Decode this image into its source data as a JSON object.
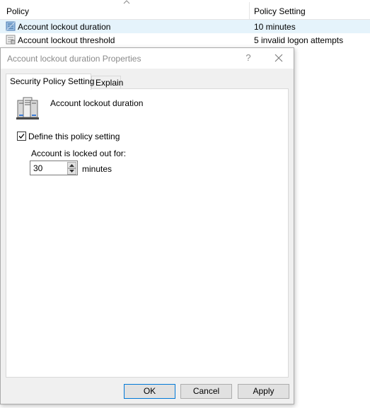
{
  "list": {
    "columns": {
      "policy": "Policy",
      "setting": "Policy Setting"
    },
    "rows": [
      {
        "name": "Account lockout duration",
        "value": "10 minutes",
        "selected": true
      },
      {
        "name": "Account lockout threshold",
        "value": "5 invalid logon attempts",
        "selected": false
      }
    ]
  },
  "dialog": {
    "title": "Account lockout duration Properties",
    "help_glyph": "?",
    "tabs": [
      {
        "label": "Security Policy Setting",
        "active": true
      },
      {
        "label": "Explain",
        "active": false
      }
    ],
    "policy_name": "Account lockout duration",
    "define_checkbox": {
      "label": "Define this policy setting",
      "checked": true
    },
    "locked_label": "Account is locked out for:",
    "duration_value": "30",
    "unit_label": "minutes",
    "buttons": {
      "ok": "OK",
      "cancel": "Cancel",
      "apply": "Apply"
    }
  },
  "colors": {
    "selected_row": "#e5f3fb",
    "dialog_bg": "#f0f0f0",
    "default_button_border": "#0078d7"
  },
  "icons": {
    "row_icon": "policy-setting-icon",
    "header_icon": "server-icon",
    "close": "close-icon"
  }
}
